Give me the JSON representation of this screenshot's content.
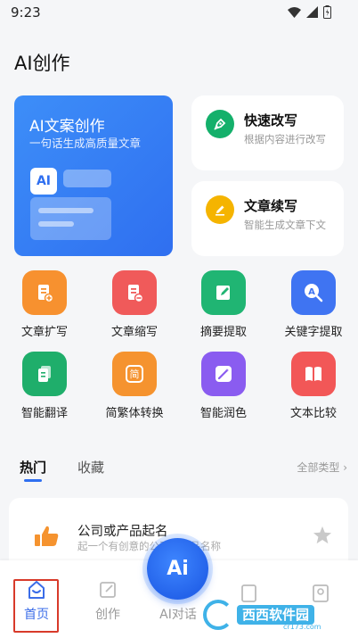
{
  "status": {
    "time": "9:23"
  },
  "header": {
    "title": "AI创作"
  },
  "hero": {
    "title": "AI文案创作",
    "subtitle": "一句话生成高质量文章",
    "badge": "AI"
  },
  "side_cards": [
    {
      "title": "快速改写",
      "desc": "根据内容进行改写",
      "color": "#14b06b"
    },
    {
      "title": "文章续写",
      "desc": "智能生成文章下文",
      "color": "#f5b400"
    }
  ],
  "tools": [
    {
      "label": "文章扩写",
      "icon": "doc-plus-icon",
      "color": "#f7912f"
    },
    {
      "label": "文章缩写",
      "icon": "doc-minus-icon",
      "color": "#f05a5a"
    },
    {
      "label": "摘要提取",
      "icon": "note-edit-icon",
      "color": "#20b573"
    },
    {
      "label": "关键字提取",
      "icon": "search-a-icon",
      "color": "#3f74f2"
    },
    {
      "label": "智能翻译",
      "icon": "copy-doc-icon",
      "color": "#1fae6b"
    },
    {
      "label": "简繁体转换",
      "icon": "convert-icon",
      "color": "#f5932f"
    },
    {
      "label": "智能润色",
      "icon": "magic-wand-icon",
      "color": "#8a5cf0"
    },
    {
      "label": "文本比较",
      "icon": "book-icon",
      "color": "#f25757"
    }
  ],
  "tabs": {
    "hot": "热门",
    "fav": "收藏",
    "all": "全部类型 ›"
  },
  "list_item": {
    "title": "公司或产品起名",
    "desc": "起一个有创意的公司或产品名称"
  },
  "nav": {
    "home": "首页",
    "create": "创作",
    "ai": "AI对话",
    "fab": "Ai"
  },
  "watermark": {
    "text": "西西软件园",
    "sub": "cr173.com"
  }
}
